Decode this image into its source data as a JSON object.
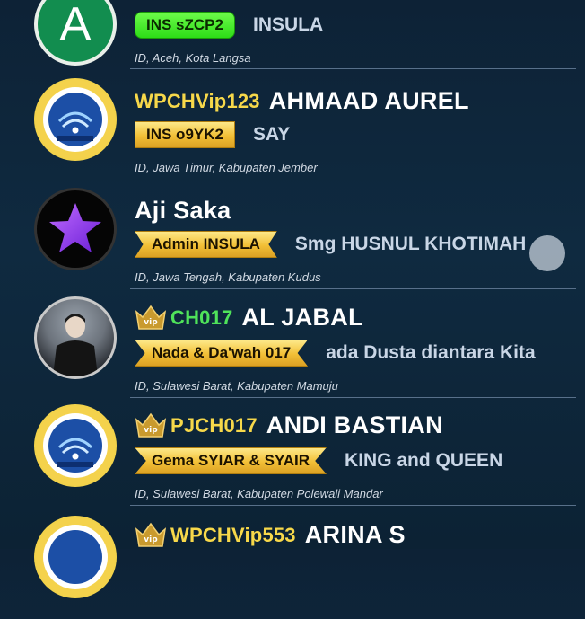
{
  "users": [
    {
      "avatar": "letter-avatar",
      "avatar_letter": "A",
      "badge_label": "INS sZCP2",
      "badge_style": "green",
      "status_text": "INSULA",
      "location": "ID, Aceh, Kota Langsa"
    },
    {
      "avatar": "insula-logo-avatar",
      "prefix": "WPCHVip123",
      "prefix_color": "#f7d84a",
      "name": "AHMAAD AUREL",
      "badge_label": "INS o9YK2",
      "badge_style": "gold",
      "status_text": "SAY",
      "location": "ID, Jawa Timur, Kabupaten Jember"
    },
    {
      "avatar": "purple-star-avatar",
      "name": "Aji Saka",
      "badge_label": "Admin INSULA",
      "badge_style": "gold",
      "status_text": "Smg HUSNUL KHOTIMAH",
      "location": "ID, Jawa Tengah, Kabupaten Kudus"
    },
    {
      "avatar": "profile-photo-avatar",
      "vip": true,
      "prefix": "CH017",
      "prefix_color": "#4fe35a",
      "name": "AL JABAL",
      "badge_label": "Nada & Da'wah 017",
      "badge_style": "gold",
      "status_text": "ada Dusta diantara Kita",
      "location": "ID, Sulawesi Barat, Kabupaten Mamuju"
    },
    {
      "avatar": "insula-logo-avatar",
      "vip": true,
      "prefix": "PJCH017",
      "prefix_color": "#f7d84a",
      "name": "ANDI BASTIAN",
      "badge_label": "Gema SYIAR & SYAIR",
      "badge_style": "gold",
      "status_text": "KING and QUEEN",
      "location": "ID, Sulawesi Barat, Kabupaten Polewali Mandar"
    },
    {
      "avatar": "insula-logo-avatar",
      "vip": true,
      "prefix": "WPCHVip553",
      "prefix_color": "#f7d84a",
      "name": "ARINA S"
    }
  ]
}
